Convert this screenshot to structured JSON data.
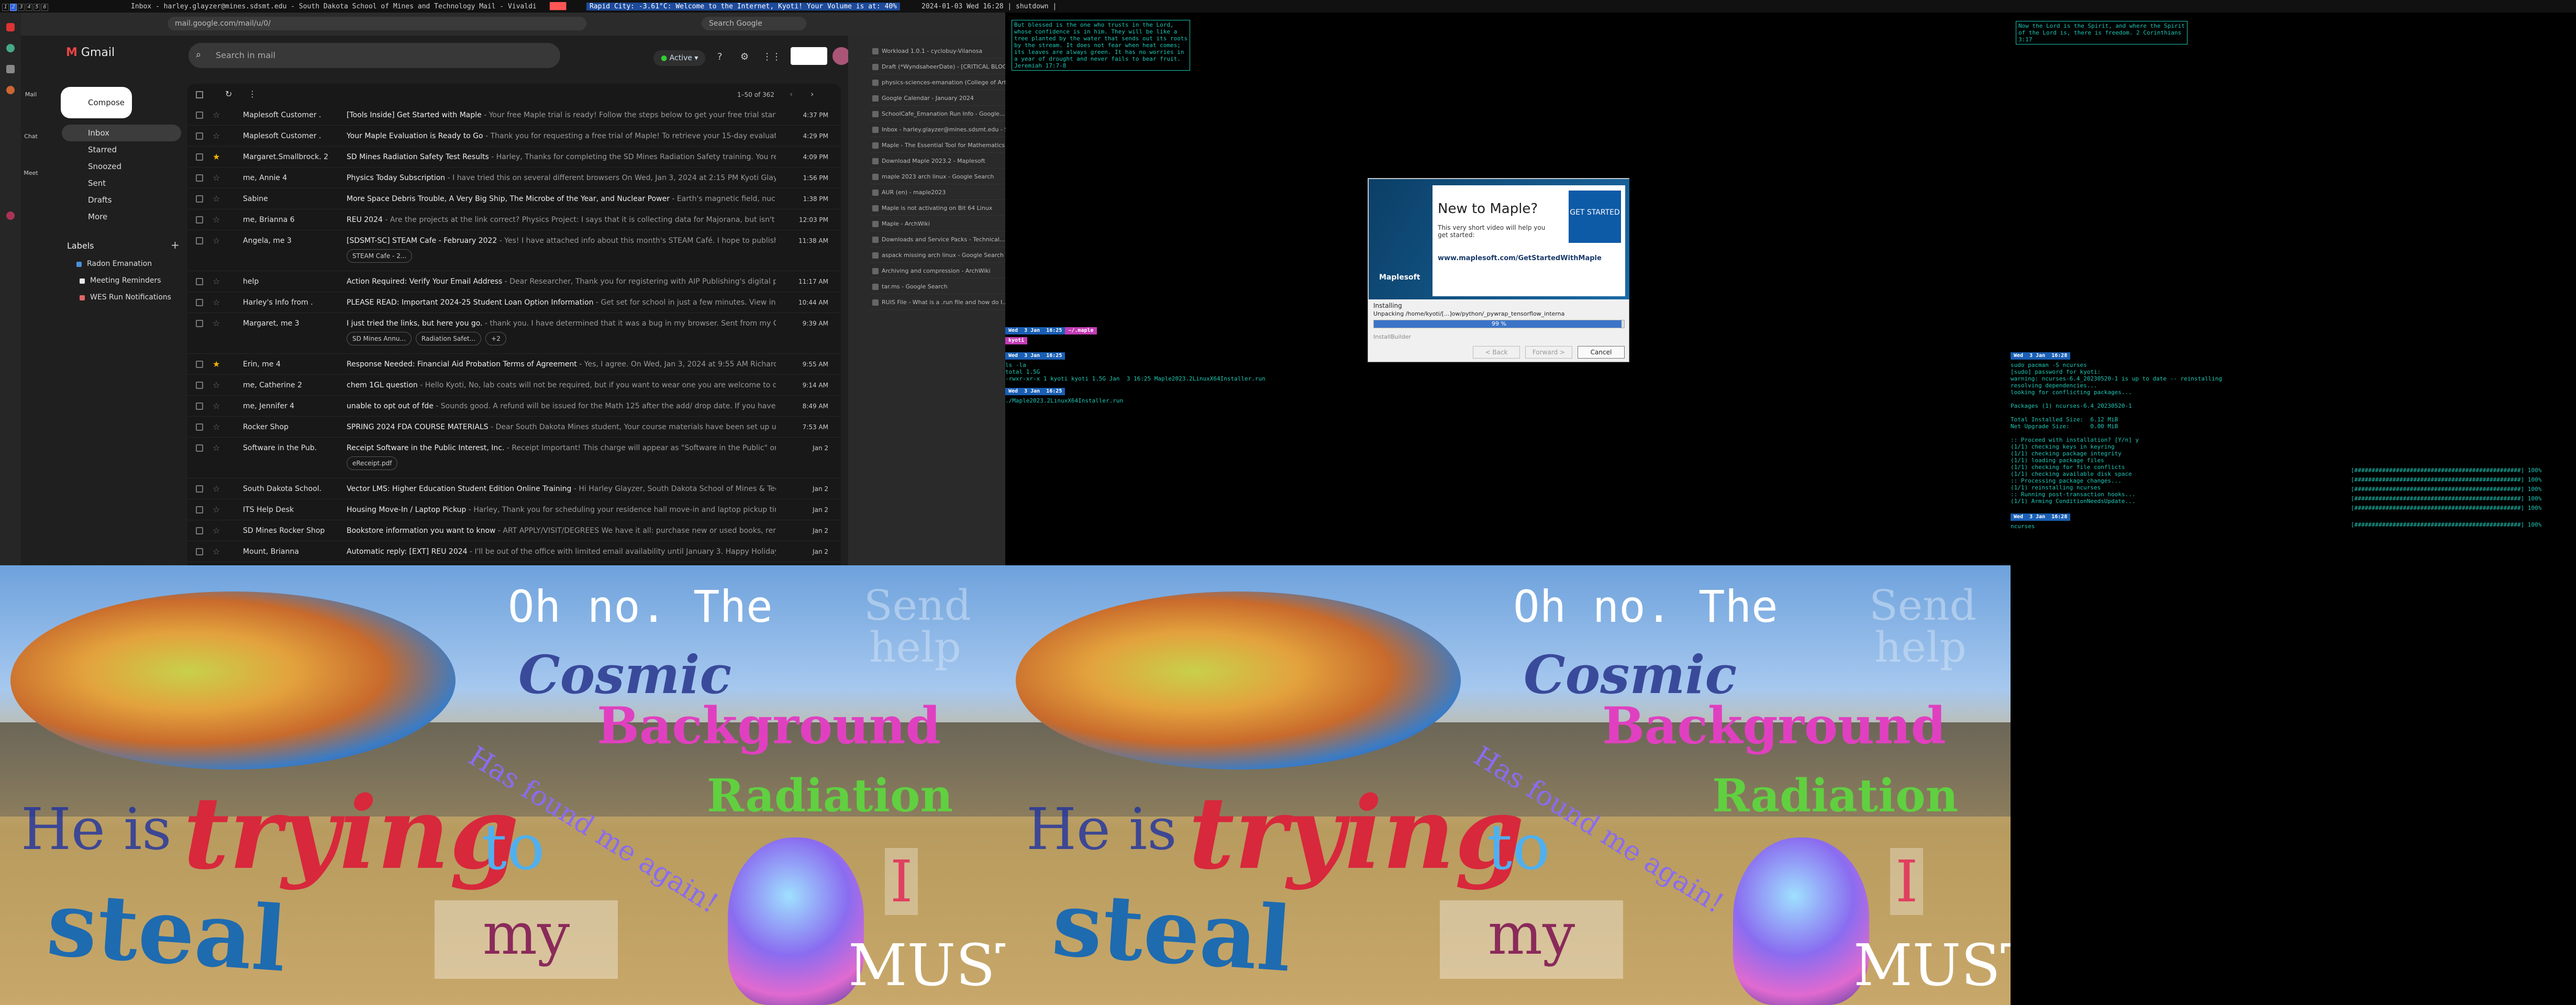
{
  "wmbar": {
    "left": "Inbox - harley.glayzer@mines.sdsmt.edu - South Dakota School of Mines and Technology Mail - Vivaldi",
    "mid_label": "Rapid City: -3.61°C: Welcome to the Internet, Kyoti! Your Volume is at: 40%",
    "right": "2024-01-03 Wed 16:28 | shutdown |",
    "workspaces": [
      "1",
      "2",
      "3",
      "4",
      "5",
      "6"
    ]
  },
  "browser": {
    "url": "mail.google.com/mail/u/0/",
    "search_placeholder": "Search Google"
  },
  "gmail": {
    "logo": "Gmail",
    "search_placeholder": "Search in mail",
    "status": "Active",
    "compose": "Compose",
    "count": "1–50 of 362",
    "nav": [
      {
        "label": "Inbox",
        "count": "",
        "active": true
      },
      {
        "label": "Starred",
        "count": ""
      },
      {
        "label": "Snoozed",
        "count": ""
      },
      {
        "label": "Sent",
        "count": ""
      },
      {
        "label": "Drafts",
        "count": ""
      },
      {
        "label": "More",
        "count": ""
      }
    ],
    "labels_title": "Labels",
    "labels": [
      {
        "name": "Radon Emanation",
        "color": "#4a90d9"
      },
      {
        "name": "Meeting Reminders",
        "color": "#e8e8e8"
      },
      {
        "name": "WES Run Notifications",
        "color": "#e06666"
      }
    ],
    "rail": [
      "Mail",
      "Chat",
      "Meet"
    ],
    "emails": [
      {
        "sender": "Maplesoft Customer .",
        "subject": "[Tools Inside] Get Started with Maple",
        "snippet": " - Your free Maple trial is ready! Follow the steps below to get your free trial started! You...",
        "date": "4:37 PM",
        "starred": false
      },
      {
        "sender": "Maplesoft Customer .",
        "subject": "Your Maple Evaluation is Ready to Go",
        "snippet": " - Thank you for requesting a free trial of Maple! To retrieve your 15-day evaluation copy, ...",
        "date": "4:29 PM",
        "starred": false
      },
      {
        "sender": "Margaret.Smallbrock. 2",
        "subject": "SD Mines Radiation Safety Test Results",
        "snippet": " - Harley, Thanks for completing the SD Mines Radiation Safety training. You received a ...",
        "date": "4:09 PM",
        "starred": true
      },
      {
        "sender": "me, Annie 4",
        "subject": "Physics Today Subscription",
        "snippet": " - I have tried this on several different browsers On Wed, Jan 3, 2024 at 2:15 PM Kyoti Glayzer <harl...",
        "date": "1:56 PM",
        "starred": false
      },
      {
        "sender": "Sabine",
        "subject": "More Space Debris Trouble, A Very Big Ship, The Microbe of the Year, and Nuclear Power",
        "snippet": " - Earth's magnetic field, nuclear boa...",
        "date": "1:38 PM",
        "starred": false
      },
      {
        "sender": "me, Brianna 6",
        "subject": "REU 2024",
        "snippet": " - Are the projects at the link correct? Physics Project: I says that it is collecting data for Majorana, but isn't majoran...",
        "date": "12:03 PM",
        "starred": false
      },
      {
        "sender": "Angela, me 3",
        "subject": "[SDSMT-SC] STEAM Cafe - February 2022",
        "snippet": " - Yes! I have attached info about this month's STEAM Café. I hope to publish a pres...",
        "date": "11:38 AM",
        "starred": false
      },
      {
        "sender": "help",
        "subject": "Action Required: Verify Your Email Address",
        "snippet": " - Dear Researcher, Thank you for registering with AIP Publishing's digital publicatio...",
        "date": "11:17 AM",
        "starred": false
      },
      {
        "sender": "Harley's Info from .",
        "subject": "PLEASE READ: Important 2024-25 Student Loan Option Information",
        "snippet": " - Get set for school in just a few minutes. View in Browser...",
        "date": "10:44 AM",
        "starred": false
      },
      {
        "sender": "Margaret, me 3",
        "subject": "I just tried the links, but here you go.",
        "snippet": " - thank you. I have determined that it was a bug in my browser. Sent from my CASIO Gra...",
        "date": "9:39 AM",
        "starred": false
      },
      {
        "sender": "Erin, me 4",
        "subject": "Response Needed: Financial Aid Probation Terms of Agreement",
        "snippet": " - Yes, I agree. On Wed, Jan 3, 2024 at 9:55 AM Richards, Erin ...",
        "date": "9:55 AM",
        "starred": true
      },
      {
        "sender": "me, Catherine 2",
        "subject": "chem 1GL question",
        "snippet": " - Hello Kyoti, No, lab coats will not be required, but if you want to wear one you are welcome to do so. I'm...",
        "date": "9:14 AM",
        "starred": false
      },
      {
        "sender": "me, Jennifer 4",
        "subject": "unable to opt out of fde",
        "snippet": " - Sounds good. A refund will be issued for the Math 125 after the add/ drop date. If you have another ...",
        "date": "8:49 AM",
        "starred": false
      },
      {
        "sender": "Rocker Shop",
        "subject": "SPRING 2024 FDA COURSE MATERIALS",
        "snippet": " - Dear South Dakota Mines student, Your course materials have been set up using the First Da...",
        "date": "7:53 AM",
        "starred": false
      },
      {
        "sender": "Software in the Pub.",
        "subject": "Receipt Software in the Public Interest, Inc.",
        "snippet": " - Receipt Important! This charge will appear as \"Software in the Public\" on your cr...",
        "date": "Jan 2",
        "starred": false
      },
      {
        "sender": "South Dakota School.",
        "subject": "Vector LMS: Higher Education Student Edition Online Training",
        "snippet": " - Hi Harley Glayzer, South Dakota School of Mines & Technology...",
        "date": "Jan 2",
        "starred": false
      },
      {
        "sender": "ITS Help Desk",
        "subject": "Housing Move-In / Laptop Pickup",
        "snippet": " - Harley, Thank you for scheduling your residence hall move-in and laptop pickup times. Th...",
        "date": "Jan 2",
        "starred": false
      },
      {
        "sender": "SD Mines Rocker Shop",
        "subject": "Bookstore information you want to know",
        "snippet": " - ART APPLY/VISIT/DEGREES We have it all: purchase new or used books, rent new or ...",
        "date": "Jan 2",
        "starred": false
      },
      {
        "sender": "Mount, Brianna",
        "subject": "Automatic reply: [EXT] REU 2024",
        "snippet": " - I'll be out of the office with limited email availability until January 3. Happy Holidays!",
        "date": "Jan 2",
        "starred": false
      }
    ],
    "chips": {
      "steam": "STEAM Cafe - 2...",
      "sdmines": "SD Mines Annu...",
      "radsafe": "Radiation Safet...",
      "plus": "+2",
      "receipt": "eReceipt.pdf"
    }
  },
  "tabs": [
    "Workload 1.0.1 - cyclobuy-Vilanosa",
    "Draft (*WyndsaheerDate) - [CRITICAL BLOC Dist...",
    "physics-sciences-emanation (College of Art...",
    "Google Calendar - January 2024",
    "SchoolCafe_Emanation Run Info - Google...",
    "Inbox - harley.glayzer@mines.sdsmt.edu - S...",
    "Maple - The Essential Tool for Mathematics...",
    "Download Maple 2023.2 - Maplesoft",
    "maple 2023 arch linux - Google Search",
    "AUR (en) - maple2023",
    "Maple is not activating on Bit 64 Linux",
    "Maple - ArchWiki",
    "Downloads and Service Packs - Technical...",
    "aspack missing arch linux - Google Search",
    "Archiving and compression - ArchWiki",
    "tar.ms - Google Search",
    "RUIS File - What is a .run file and how do I..."
  ],
  "terminal": {
    "verse_left": "But blessed is the one who trusts in the Lord,\nwhose confidence is in him. They will be like a\ntree planted by the water that sends out its roots\nby the stream. It does not fear when heat comes;\nits leaves are always green. It has no worries in\na year of drought and never fails to bear fruit.\nJeremiah 17:7-8",
    "verse_right": "Now the Lord is the Spirit, and where the Spirit\nof the Lord is, there is freedom. 2 Corinthians\n3:17",
    "p1_date": "Wed  3 Jan  16:25",
    "p1_user": "kyoti",
    "p1_dir": "~/.maple",
    "p2_date": "Wed  3 Jan  16:25",
    "p2_cmd": "ls -la",
    "p2_out": "total 1.5G\n-rwxr-xr-x 1 kyoti kyoti 1.5G Jan  3 16:25 Maple2023.2LinuxX64Installer.run",
    "p3_date": "Wed  3 Jan  16:25",
    "p3_cmd": "./Maple2023.2LinuxX64Installer.run",
    "r_date": "Wed  3 Jan  16:28",
    "r_cmd": "sudo pacman -S ncurses",
    "r_out": "[sudo] password for kyoti:\nwarning: ncurses-6.4_20230520-1 is up to date -- reinstalling\nresolving dependencies...\nlooking for conflicting packages...\n\nPackages (1) ncurses-6.4_20230520-1\n\nTotal Installed Size:  6.12 MiB\nNet Upgrade Size:      0.00 MiB\n\n:: Proceed with installation? [Y/n] y\n(1/1) checking keys in keyring\n(1/1) checking package integrity\n(1/1) loading package files\n(1/1) checking for file conflicts\n(1/1) checking available disk space\n:: Processing package changes...\n(1/1) reinstalling ncurses\n:: Running post-transaction hooks...\n(1/1) Arming ConditionNeedsUpdate...",
    "r2_date": "Wed  3 Jan  16:28",
    "r2_cmd": "ncurses",
    "progress": "[################################################] 100%"
  },
  "maple_dialog": {
    "title": "New to Maple?",
    "sub": "This very short video will help you get started:",
    "url": "www.maplesoft.com/GetStartedWithMaple",
    "started": "GET STARTED",
    "brand": "Maplesoft",
    "installing": "Installing",
    "unpacking": "Unpacking /home/kyoti/[...]ow/python/_pywrap_tensorflow_interna",
    "percent": "99 %",
    "installbuilder": "InstallBuilder",
    "back": "< Back",
    "forward": "Forward >",
    "cancel": "Cancel"
  },
  "wallpaper": {
    "oh": "Oh no. The",
    "cosmic": "Cosmic",
    "background": "Background",
    "radiation": "Radiation",
    "found": "Has found me again!",
    "he": "He is",
    "trying": "trying",
    "to": "to",
    "steal": "steal",
    "my": "my",
    "i": "I",
    "must": "MUST",
    "send": "Send",
    "help": "help"
  }
}
